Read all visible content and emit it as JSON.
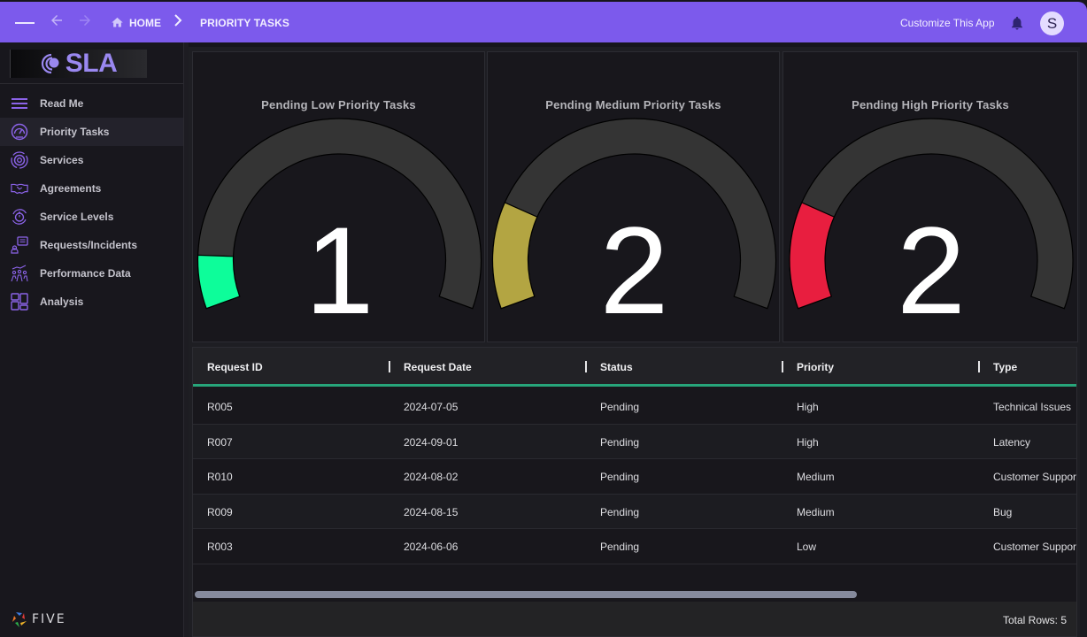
{
  "topbar": {
    "breadcrumb_home": "HOME",
    "breadcrumb_separator": "›",
    "breadcrumb_current": "PRIORITY TASKS",
    "customize_label": "Customize This App",
    "avatar_initial": "S",
    "icons": {
      "menu": "hamburger-icon",
      "back": "arrow-left-icon",
      "forward": "arrow-right-icon",
      "home": "home-icon",
      "notifications": "bell-icon"
    },
    "colors": {
      "background": "#7c5aec"
    }
  },
  "sidebar": {
    "logo_text": "SLA",
    "footer_brand": "FIVE",
    "items": [
      {
        "label": "Read Me",
        "icon": "menu-lines-icon",
        "active": false
      },
      {
        "label": "Priority Tasks",
        "icon": "speedometer-icon",
        "active": true
      },
      {
        "label": "Services",
        "icon": "gear-circle-icon",
        "active": false
      },
      {
        "label": "Agreements",
        "icon": "handshake-icon",
        "active": false
      },
      {
        "label": "Service Levels",
        "icon": "stopwatch-cycle-icon",
        "active": false
      },
      {
        "label": "Requests/Incidents",
        "icon": "user-message-icon",
        "active": false
      },
      {
        "label": "Performance Data",
        "icon": "team-growth-icon",
        "active": false
      },
      {
        "label": "Analysis",
        "icon": "dashboard-grid-icon",
        "active": false
      }
    ],
    "accent_color": "#8b63e8"
  },
  "gauges": [
    {
      "title": "Pending Low Priority Tasks",
      "value": 1,
      "display": "1",
      "min": 0,
      "max": 10,
      "color": "#0dfd9a"
    },
    {
      "title": "Pending Medium Priority Tasks",
      "value": 2,
      "display": "2",
      "min": 0,
      "max": 10,
      "color": "#b3a542"
    },
    {
      "title": "Pending High Priority Tasks",
      "value": 2,
      "display": "2",
      "min": 0,
      "max": 10,
      "color": "#e81e3f"
    }
  ],
  "table": {
    "columns": [
      "Request ID",
      "Request Date",
      "Status",
      "Priority",
      "Type"
    ],
    "rows": [
      [
        "R005",
        "2024-07-05",
        "Pending",
        "High",
        "Technical Issues"
      ],
      [
        "R007",
        "2024-09-01",
        "Pending",
        "High",
        "Latency"
      ],
      [
        "R010",
        "2024-08-02",
        "Pending",
        "Medium",
        "Customer Support"
      ],
      [
        "R009",
        "2024-08-15",
        "Pending",
        "Medium",
        "Bug"
      ],
      [
        "R003",
        "2024-06-06",
        "Pending",
        "Low",
        "Customer Support"
      ]
    ],
    "total_rows_label": "Total Rows: 5",
    "header_accent": "#27a57a"
  }
}
